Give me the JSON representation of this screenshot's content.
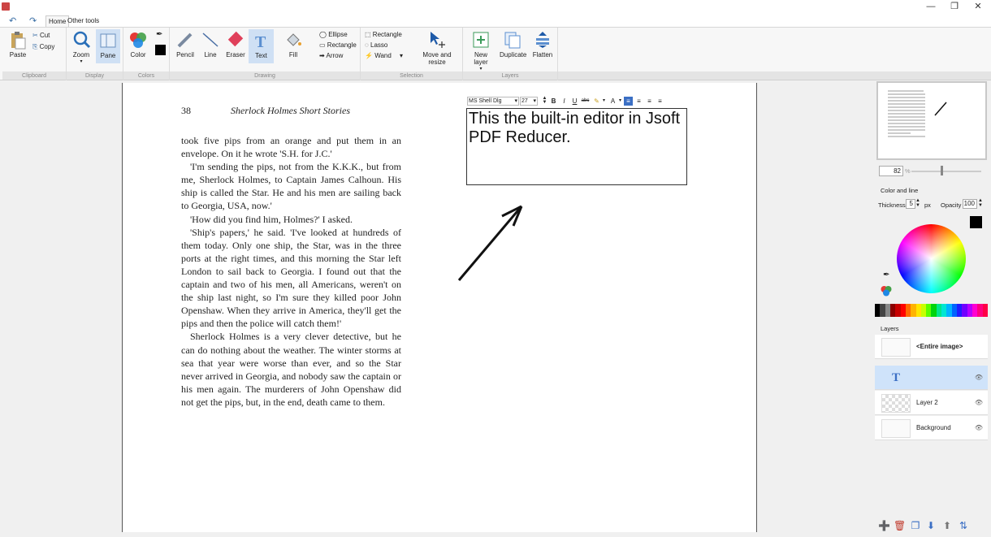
{
  "window": {
    "minimize": "—",
    "maximize": "❐",
    "close": "✕"
  },
  "quick_access": {
    "undo": "↶",
    "redo": "↷"
  },
  "tabs": [
    {
      "label": "Home"
    },
    {
      "label": "Other tools"
    }
  ],
  "ribbon": {
    "clipboard": {
      "paste": "Paste",
      "cut": "Cut",
      "copy": "Copy",
      "group": "Clipboard"
    },
    "display": {
      "zoom": "Zoom",
      "pane": "Pane",
      "group": "Display"
    },
    "colors": {
      "color": "Color",
      "group": "Colors"
    },
    "drawing": {
      "pencil": "Pencil",
      "line": "Line",
      "eraser": "Eraser",
      "text": "Text",
      "fill": "Fill",
      "ellipse": "Ellipse",
      "rectangle": "Rectangle",
      "arrow": "Arrow",
      "group": "Drawing"
    },
    "selection": {
      "rectangle": "Rectangle",
      "lasso": "Lasso",
      "wand": "Wand",
      "move_resize": "Move and resize",
      "group": "Selection"
    },
    "layers": {
      "new_layer": "New layer",
      "duplicate": "Duplicate",
      "flatten": "Flatten",
      "group": "Layers"
    }
  },
  "document": {
    "page_number": "38",
    "running_head": "Sherlock Holmes Short Stories",
    "paragraphs": [
      "took five pips from an orange and put them in an envelope. On it he wrote 'S.H. for J.C.'",
      "'I'm sending the pips, not from the K.K.K., but from me, Sherlock Holmes, to Captain James Calhoun. His ship is called the Star. He and his men are sailing back to Georgia, USA, now.'",
      "'How did you find him, Holmes?' I asked.",
      "'Ship's papers,' he said. 'I've looked at hundreds of them today. Only one ship, the Star, was in the three ports at the right times, and this morning the Star left London to sail back to Georgia. I found out that the captain and two of his men, all Americans, weren't on the ship last night, so I'm sure they killed poor John Openshaw. When they arrive in America, they'll get the pips and then the police will catch them!'",
      "Sherlock Holmes is a very clever detective, but he can do nothing about the weather. The winter storms at sea that year were worse than ever, and so the Star never arrived in Georgia, and nobody saw the captain or his men again. The murderers of John Openshaw did not get the pips, but, in the end, death came to them."
    ]
  },
  "text_editor": {
    "font": "MS Shell Dlg",
    "size": "27",
    "bold": "B",
    "italic": "I",
    "underline": "U",
    "strike": "abc",
    "font_color": "A",
    "content": "This the built-in editor in Jsoft PDF Reducer."
  },
  "right_panel": {
    "zoom_value": "82",
    "zoom_unit": "%",
    "section_color": "Color and line",
    "thickness_label": "Thickness",
    "thickness_value": "5",
    "thickness_unit": "px",
    "opacity_label": "Opacity",
    "opacity_value": "100",
    "current_color": "#000000",
    "layers_title": "Layers",
    "layers": [
      {
        "name": "<Entire image>",
        "type": "entire"
      },
      {
        "name": "T",
        "type": "text",
        "selected": true
      },
      {
        "name": "Layer 2",
        "type": "layer"
      },
      {
        "name": "Background",
        "type": "background"
      }
    ],
    "palette": [
      "#000000",
      "#444444",
      "#888888",
      "#8b0000",
      "#c80000",
      "#ff0000",
      "#ff6a00",
      "#ffb300",
      "#ffe600",
      "#c8ff00",
      "#5cff00",
      "#00d40c",
      "#00e68a",
      "#00e6d2",
      "#00b4ff",
      "#0064ff",
      "#1e1eff",
      "#7000ff",
      "#b400ff",
      "#ff00d2",
      "#ff0080",
      "#ff0046"
    ]
  }
}
